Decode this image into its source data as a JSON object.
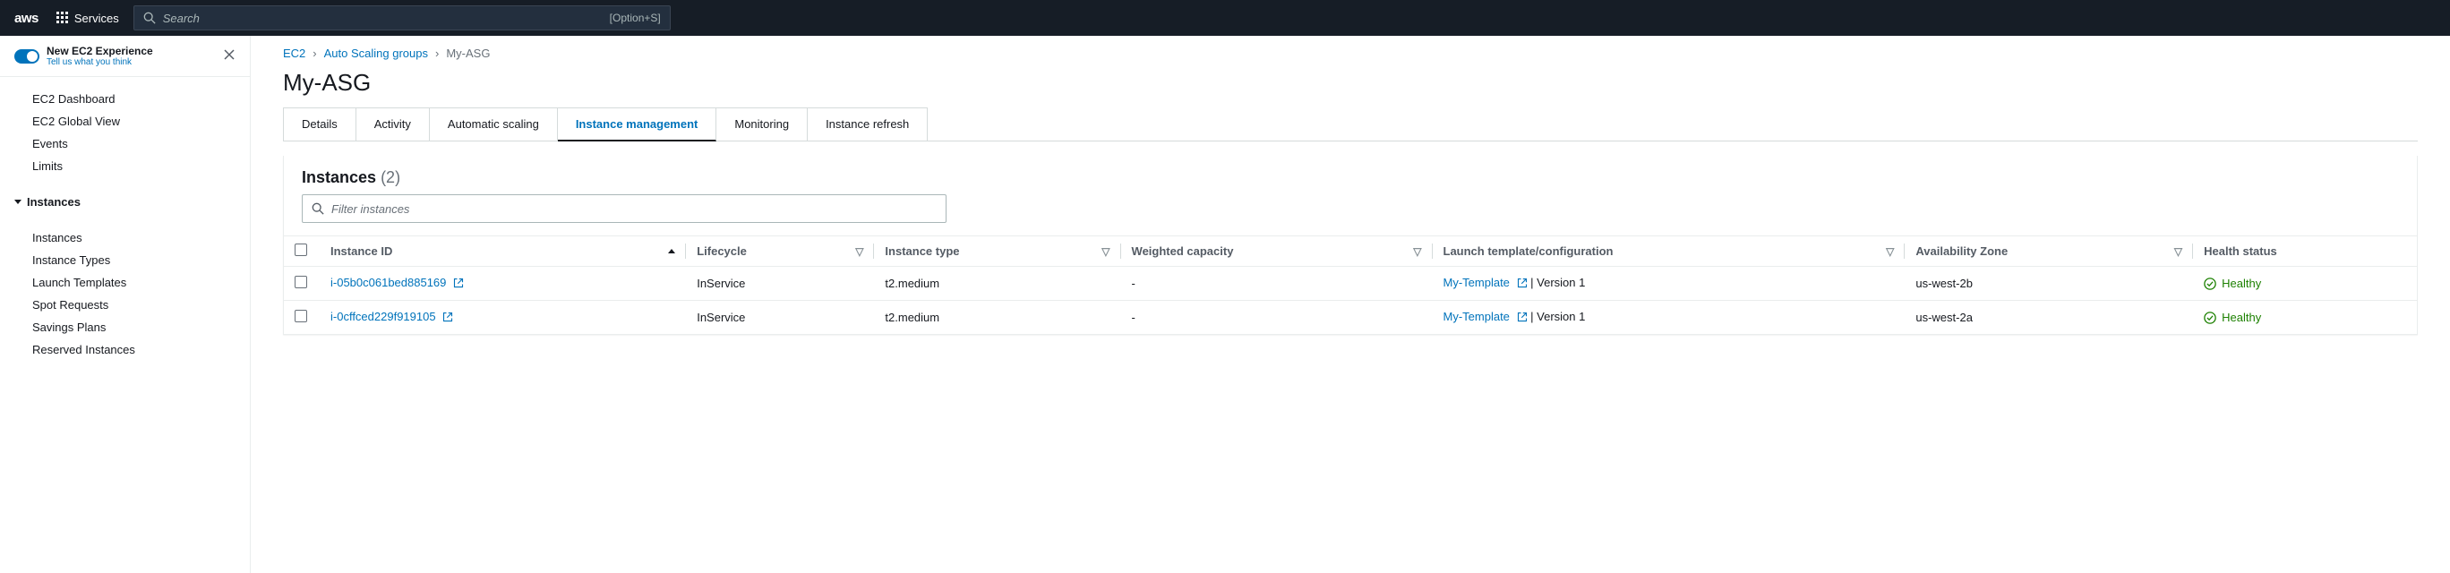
{
  "topnav": {
    "logo": "aws",
    "services": "Services",
    "search_placeholder": "Search",
    "search_hint": "[Option+S]"
  },
  "sidebar": {
    "toggle_title": "New EC2 Experience",
    "toggle_sub": "Tell us what you think",
    "items_top": [
      "EC2 Dashboard",
      "EC2 Global View",
      "Events",
      "Limits"
    ],
    "section_header": "Instances",
    "items_instances": [
      "Instances",
      "Instance Types",
      "Launch Templates",
      "Spot Requests",
      "Savings Plans",
      "Reserved Instances"
    ]
  },
  "breadcrumb": {
    "items": [
      "EC2",
      "Auto Scaling groups"
    ],
    "current": "My-ASG"
  },
  "page": {
    "title": "My-ASG"
  },
  "tabs": [
    "Details",
    "Activity",
    "Automatic scaling",
    "Instance management",
    "Monitoring",
    "Instance refresh"
  ],
  "active_tab": "Instance management",
  "panel": {
    "title": "Instances",
    "count": "(2)",
    "filter_placeholder": "Filter instances"
  },
  "table": {
    "columns": [
      "Instance ID",
      "Lifecycle",
      "Instance type",
      "Weighted capacity",
      "Launch template/configuration",
      "Availability Zone",
      "Health status"
    ],
    "rows": [
      {
        "id": "i-05b0c061bed885169",
        "lifecycle": "InService",
        "type": "t2.medium",
        "weighted": "-",
        "template_name": "My-Template",
        "template_version": "| Version 1",
        "az": "us-west-2b",
        "health": "Healthy"
      },
      {
        "id": "i-0cffced229f919105",
        "lifecycle": "InService",
        "type": "t2.medium",
        "weighted": "-",
        "template_name": "My-Template",
        "template_version": "| Version 1",
        "az": "us-west-2a",
        "health": "Healthy"
      }
    ]
  }
}
